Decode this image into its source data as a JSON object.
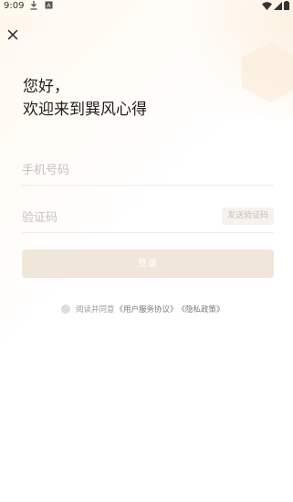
{
  "status_bar": {
    "time": "9:09",
    "download_icon": "download-icon",
    "notification_icon": "a-notification-icon",
    "right_icons": [
      "wifi-icon",
      "signal-icon",
      "battery-icon"
    ]
  },
  "header": {
    "close_icon": "close-icon"
  },
  "greeting": {
    "line1": "您好，",
    "line2": "欢迎来到巽风心得"
  },
  "form": {
    "phone_placeholder": "手机号码",
    "phone_value": "",
    "code_placeholder": "验证码",
    "code_value": "",
    "send_code_label": "发送验证码",
    "login_label": "登录"
  },
  "agreement": {
    "prefix": "阅读并同意",
    "user_agreement": "《用户服务协议》",
    "privacy_policy": "《隐私政策》"
  },
  "colors": {
    "login_button_bg": "#f1e6da",
    "send_code_bg": "#f6f3ef",
    "accent_bg": "#fff8ee"
  }
}
